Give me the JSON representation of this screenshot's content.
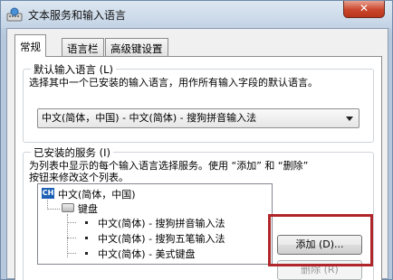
{
  "window": {
    "title": "文本服务和输入语言",
    "close_label": "✕",
    "title_icon": "keyboard-globe-icon"
  },
  "tabs": [
    {
      "label": "常规",
      "active": true
    },
    {
      "label": "语言栏",
      "active": false
    },
    {
      "label": "高级键设置",
      "active": false
    }
  ],
  "default_language": {
    "group_title": "默认输入语言 (L)",
    "description": "选择其中一个已安装的输入语言，用作所有输入字段的默认语言。",
    "selected_value": "中文(简体，中国) - 中文(简体) - 搜狗拼音输入法"
  },
  "installed_services": {
    "group_title": "已安装的服务 (I)",
    "description_line1": "为列表中显示的每个输入语言选择服务。使用 “添加” 和 “删除”",
    "description_line2": "按钮来修改这个列表。",
    "tree": {
      "language": "中文(简体，中国)",
      "language_code": "CH",
      "category": "键盘",
      "items": [
        "中文(简体) - 搜狗拼音输入法",
        "中文(简体) - 搜狗五笔输入法",
        "中文(简体) - 美式键盘"
      ]
    },
    "add_button": "添加 (D)...",
    "remove_button": "删除 (R)"
  },
  "colors": {
    "highlight_box": "#b0262a",
    "accent": "#1c5fb5"
  }
}
